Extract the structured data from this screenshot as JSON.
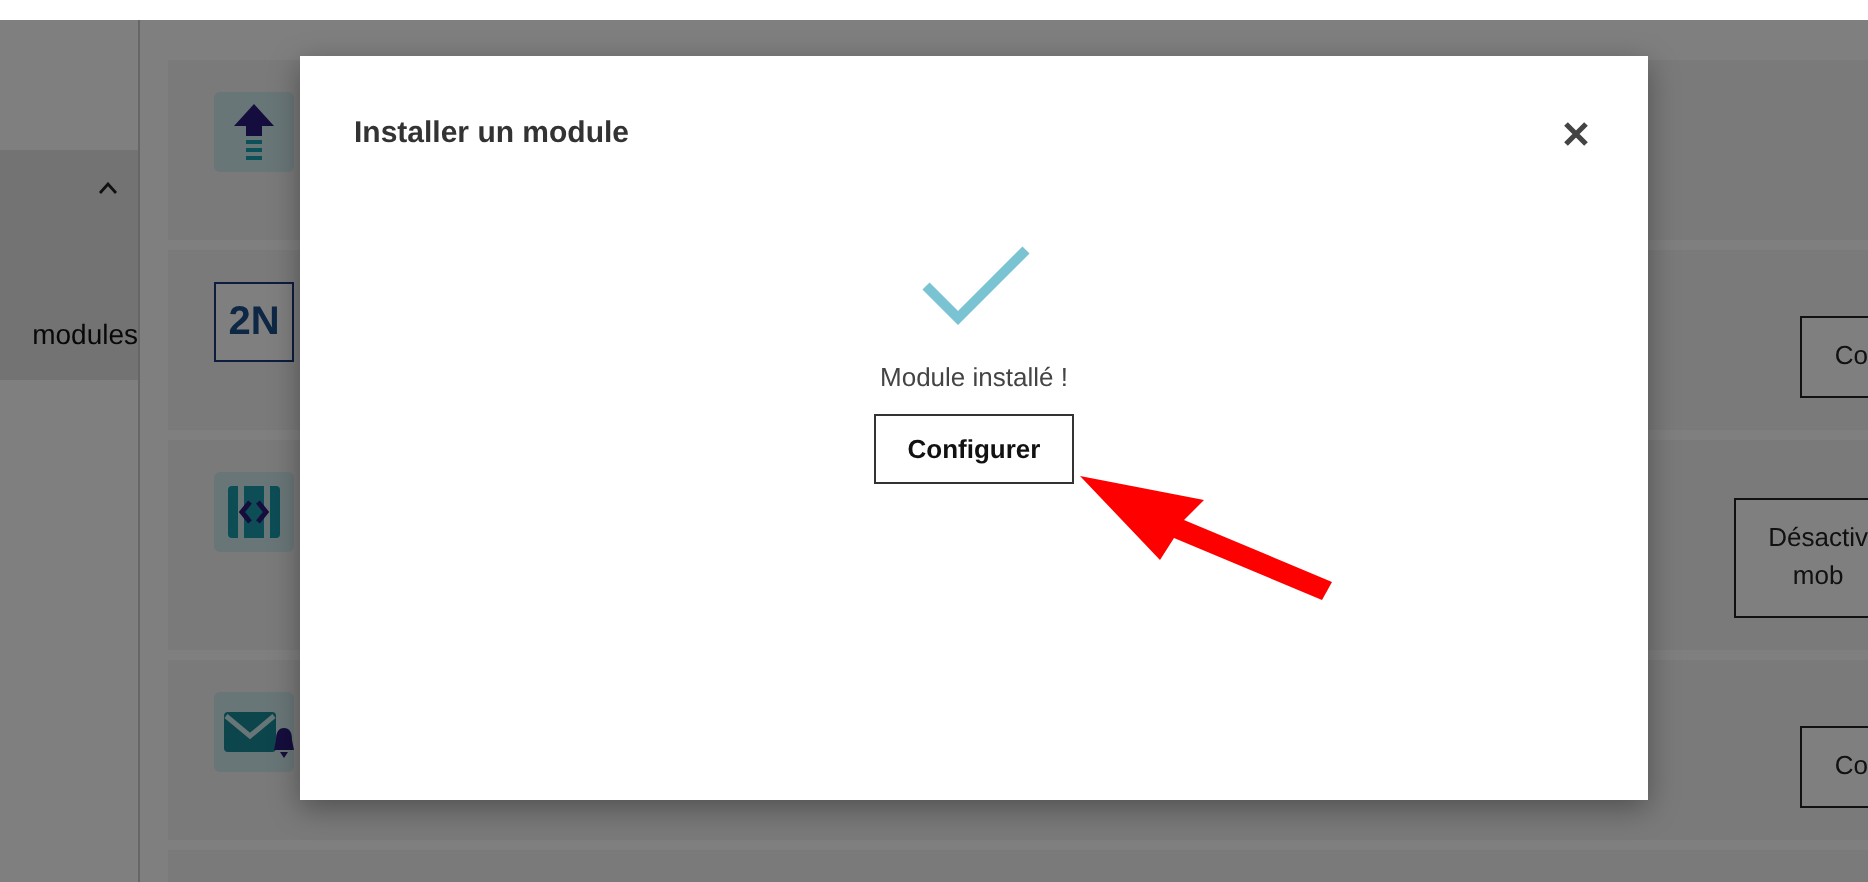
{
  "sidebar": {
    "section": {
      "label": "modules",
      "expanded": true
    }
  },
  "modules": [
    {
      "kind": "upload"
    },
    {
      "kind": "logo",
      "logo_text": "2N",
      "actions": [
        {
          "lines": [
            "Co"
          ]
        }
      ]
    },
    {
      "kind": "code",
      "actions": [
        {
          "lines": [
            "Désactiv",
            "mob"
          ]
        }
      ]
    },
    {
      "kind": "mail",
      "actions": [
        {
          "lines": [
            "Co"
          ]
        }
      ]
    },
    {
      "kind": "blank"
    }
  ],
  "modal": {
    "title": "Installer un module",
    "status": "Module installé !",
    "button": "Configurer"
  }
}
